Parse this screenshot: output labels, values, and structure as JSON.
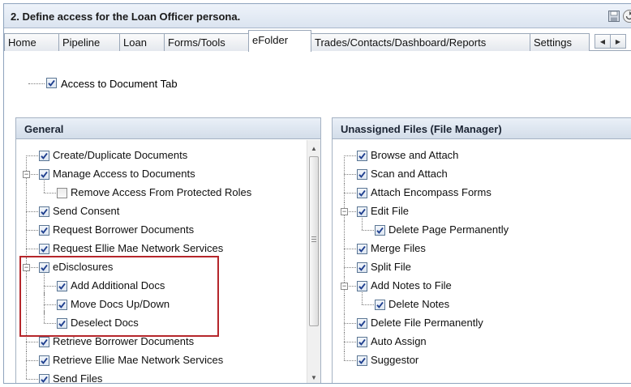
{
  "title": "2. Define access for the Loan Officer persona.",
  "title_icons": [
    "save-icon",
    "restore-icon"
  ],
  "tabs": [
    {
      "label": "Home",
      "active": false
    },
    {
      "label": "Pipeline",
      "active": false
    },
    {
      "label": "Loan",
      "active": false
    },
    {
      "label": "Forms/Tools",
      "active": false
    },
    {
      "label": "eFolder",
      "active": true
    },
    {
      "label": "Trades/Contacts/Dashboard/Reports",
      "active": false
    },
    {
      "label": "Settings",
      "active": false
    }
  ],
  "top_checkbox": {
    "label": "Access to Document Tab",
    "checked": true
  },
  "general": {
    "header": "General",
    "items": [
      {
        "label": "Create/Duplicate Documents",
        "checked": true,
        "level": 0,
        "expander": ""
      },
      {
        "label": "Manage Access to Documents",
        "checked": true,
        "level": 0,
        "expander": "−"
      },
      {
        "label": "Remove Access From Protected Roles",
        "checked": false,
        "level": 1,
        "expander": ""
      },
      {
        "label": "Send Consent",
        "checked": true,
        "level": 0,
        "expander": ""
      },
      {
        "label": "Request Borrower Documents",
        "checked": true,
        "level": 0,
        "expander": ""
      },
      {
        "label": "Request Ellie Mae Network Services",
        "checked": true,
        "level": 0,
        "expander": ""
      },
      {
        "label": "eDisclosures",
        "checked": true,
        "level": 0,
        "expander": "−"
      },
      {
        "label": "Add Additional Docs",
        "checked": true,
        "level": 1,
        "expander": ""
      },
      {
        "label": "Move Docs Up/Down",
        "checked": true,
        "level": 1,
        "expander": ""
      },
      {
        "label": "Deselect Docs",
        "checked": true,
        "level": 1,
        "expander": ""
      },
      {
        "label": "Retrieve Borrower Documents",
        "checked": true,
        "level": 0,
        "expander": ""
      },
      {
        "label": "Retrieve Ellie Mae Network Services",
        "checked": true,
        "level": 0,
        "expander": ""
      },
      {
        "label": "Send Files",
        "checked": true,
        "level": 0,
        "expander": ""
      }
    ]
  },
  "unassigned": {
    "header": "Unassigned Files (File Manager)",
    "items": [
      {
        "label": "Browse and Attach",
        "checked": true,
        "level": 0,
        "expander": ""
      },
      {
        "label": "Scan and Attach",
        "checked": true,
        "level": 0,
        "expander": ""
      },
      {
        "label": "Attach Encompass Forms",
        "checked": true,
        "level": 0,
        "expander": ""
      },
      {
        "label": "Edit File",
        "checked": true,
        "level": 0,
        "expander": "−"
      },
      {
        "label": "Delete Page Permanently",
        "checked": true,
        "level": 1,
        "expander": ""
      },
      {
        "label": "Merge Files",
        "checked": true,
        "level": 0,
        "expander": ""
      },
      {
        "label": "Split File",
        "checked": true,
        "level": 0,
        "expander": ""
      },
      {
        "label": "Add Notes to File",
        "checked": true,
        "level": 0,
        "expander": "−"
      },
      {
        "label": "Delete Notes",
        "checked": true,
        "level": 1,
        "expander": ""
      },
      {
        "label": "Delete File Permanently",
        "checked": true,
        "level": 0,
        "expander": ""
      },
      {
        "label": "Auto Assign",
        "checked": true,
        "level": 0,
        "expander": ""
      },
      {
        "label": "Suggestor",
        "checked": true,
        "level": 0,
        "expander": ""
      }
    ]
  },
  "colors": {
    "check": "#1f3f8f",
    "highlight": "#b5262b"
  }
}
